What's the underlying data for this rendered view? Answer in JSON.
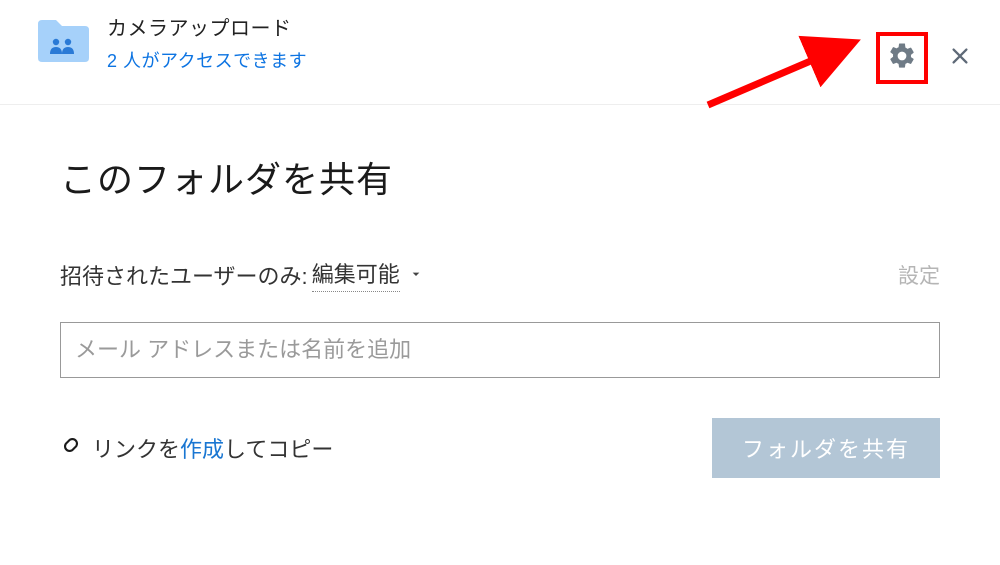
{
  "header": {
    "folder_name": "カメラアップロード",
    "access_line": "2 人がアクセスできます"
  },
  "main": {
    "share_heading": "このフォルダを共有",
    "permission_label": "招待されたユーザーのみ:",
    "permission_value": "編集可能",
    "settings_link": "設定",
    "email_placeholder": "メール アドレスまたは名前を追加",
    "link_create_prefix": "リンクを",
    "link_create_action": "作成",
    "link_create_suffix": " してコピー",
    "share_button": "フォルダを共有"
  },
  "colors": {
    "accent_blue": "#1976d2",
    "highlight_red": "#ff0000",
    "folder_blue": "#a6d1fa"
  }
}
